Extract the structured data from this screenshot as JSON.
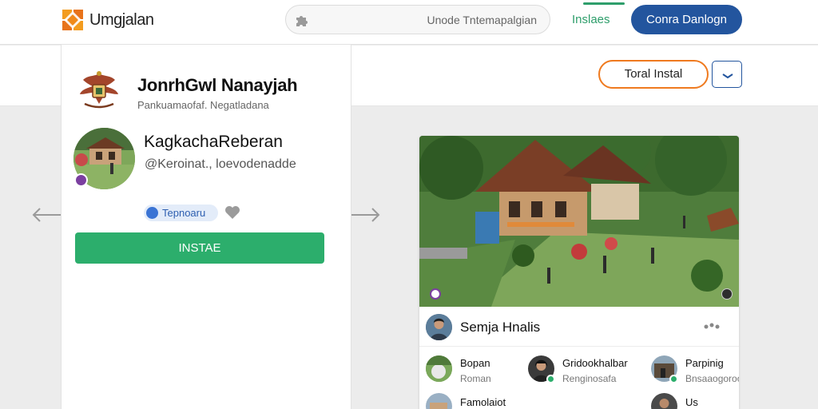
{
  "header": {
    "brand": "Umgjalan",
    "search_text": "Unode Tntemapalgian",
    "tab_label": "Inslaes",
    "connect_label": "Conra Danlogn"
  },
  "toolbar": {
    "total_label": "Toral Instal"
  },
  "profile": {
    "name": "JonrhGwl Nanayjah",
    "subtitle": "Pankuamaofaf. Negatladana",
    "account_name": "KagkachaReberan",
    "account_handle": "@Keroinat., loevodenadde",
    "tag_label": "Tepnoaru",
    "install_label": "INSTAE"
  },
  "panel": {
    "user_name": "Semja Hnalis",
    "contacts": [
      {
        "name": "Bopan",
        "sub": "Roman"
      },
      {
        "name": "Gridookhalbar",
        "sub": "Renginosafa"
      },
      {
        "name": "Parpinig",
        "sub": "Bnsaaogoroo"
      },
      {
        "name": "Famolaiot",
        "sub": ""
      },
      {
        "name": "Us",
        "sub": ""
      }
    ]
  },
  "colors": {
    "primary_blue": "#23559e",
    "install_green": "#2cae6c",
    "accent_orange": "#ef7a1f",
    "tab_green": "#2e9e6b"
  }
}
